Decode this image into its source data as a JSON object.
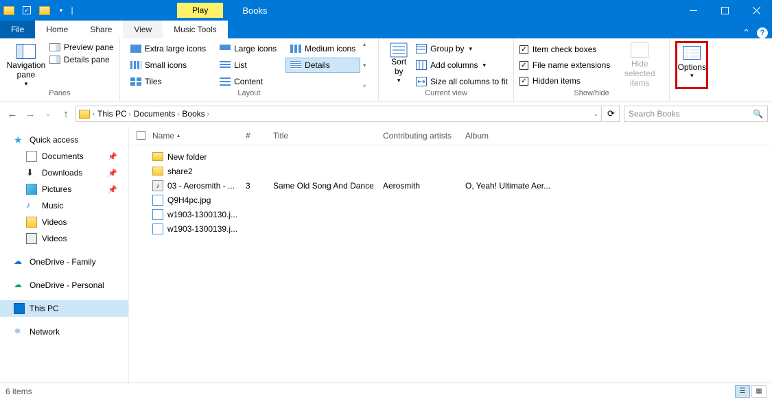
{
  "titlebar": {
    "play_tab": "Play",
    "title": "Books"
  },
  "tabs": {
    "file": "File",
    "home": "Home",
    "share": "Share",
    "view": "View",
    "music": "Music Tools"
  },
  "ribbon": {
    "panes": {
      "nav": "Navigation\npane",
      "preview": "Preview pane",
      "details": "Details pane",
      "label": "Panes",
      "drop": "▾"
    },
    "layout": {
      "xl": "Extra large icons",
      "lg": "Large icons",
      "md": "Medium icons",
      "sm": "Small icons",
      "list": "List",
      "det": "Details",
      "tiles": "Tiles",
      "content": "Content",
      "label": "Layout"
    },
    "current": {
      "sort": "Sort\nby",
      "group": "Group by",
      "addcols": "Add columns",
      "sizeall": "Size all columns to fit",
      "label": "Current view",
      "drop": "▾"
    },
    "showhide": {
      "item_chk": "Item check boxes",
      "ext": "File name extensions",
      "hidden": "Hidden items",
      "hide_sel": "Hide selected\nitems",
      "label": "Show/hide"
    },
    "options": {
      "label": "Options",
      "drop": "▾"
    }
  },
  "address": {
    "crumbs": [
      "This PC",
      "Documents",
      "Books"
    ],
    "search_placeholder": "Search Books"
  },
  "sidebar": {
    "quick": "Quick access",
    "docs": "Documents",
    "dl": "Downloads",
    "pics": "Pictures",
    "music": "Music",
    "videos1": "Videos",
    "videos2": "Videos",
    "od_fam": "OneDrive - Family",
    "od_pers": "OneDrive - Personal",
    "pc": "This PC",
    "net": "Network"
  },
  "columns": {
    "name": "Name",
    "num": "#",
    "title": "Title",
    "artist": "Contributing artists",
    "album": "Album"
  },
  "files": [
    {
      "type": "folder",
      "name": "New folder",
      "num": "",
      "title": "",
      "artist": "",
      "album": ""
    },
    {
      "type": "folder",
      "name": "share2",
      "num": "",
      "title": "",
      "artist": "",
      "album": ""
    },
    {
      "type": "audio",
      "name": "03 - Aerosmith - ...",
      "num": "3",
      "title": "Same Old Song And Dance",
      "artist": "Aerosmith",
      "album": "O, Yeah! Ultimate Aer..."
    },
    {
      "type": "image",
      "name": "Q9H4pc.jpg",
      "num": "",
      "title": "",
      "artist": "",
      "album": ""
    },
    {
      "type": "image",
      "name": "w1903-1300130.j...",
      "num": "",
      "title": "",
      "artist": "",
      "album": ""
    },
    {
      "type": "image",
      "name": "w1903-1300139.j...",
      "num": "",
      "title": "",
      "artist": "",
      "album": ""
    }
  ],
  "status": {
    "count": "6 items"
  }
}
